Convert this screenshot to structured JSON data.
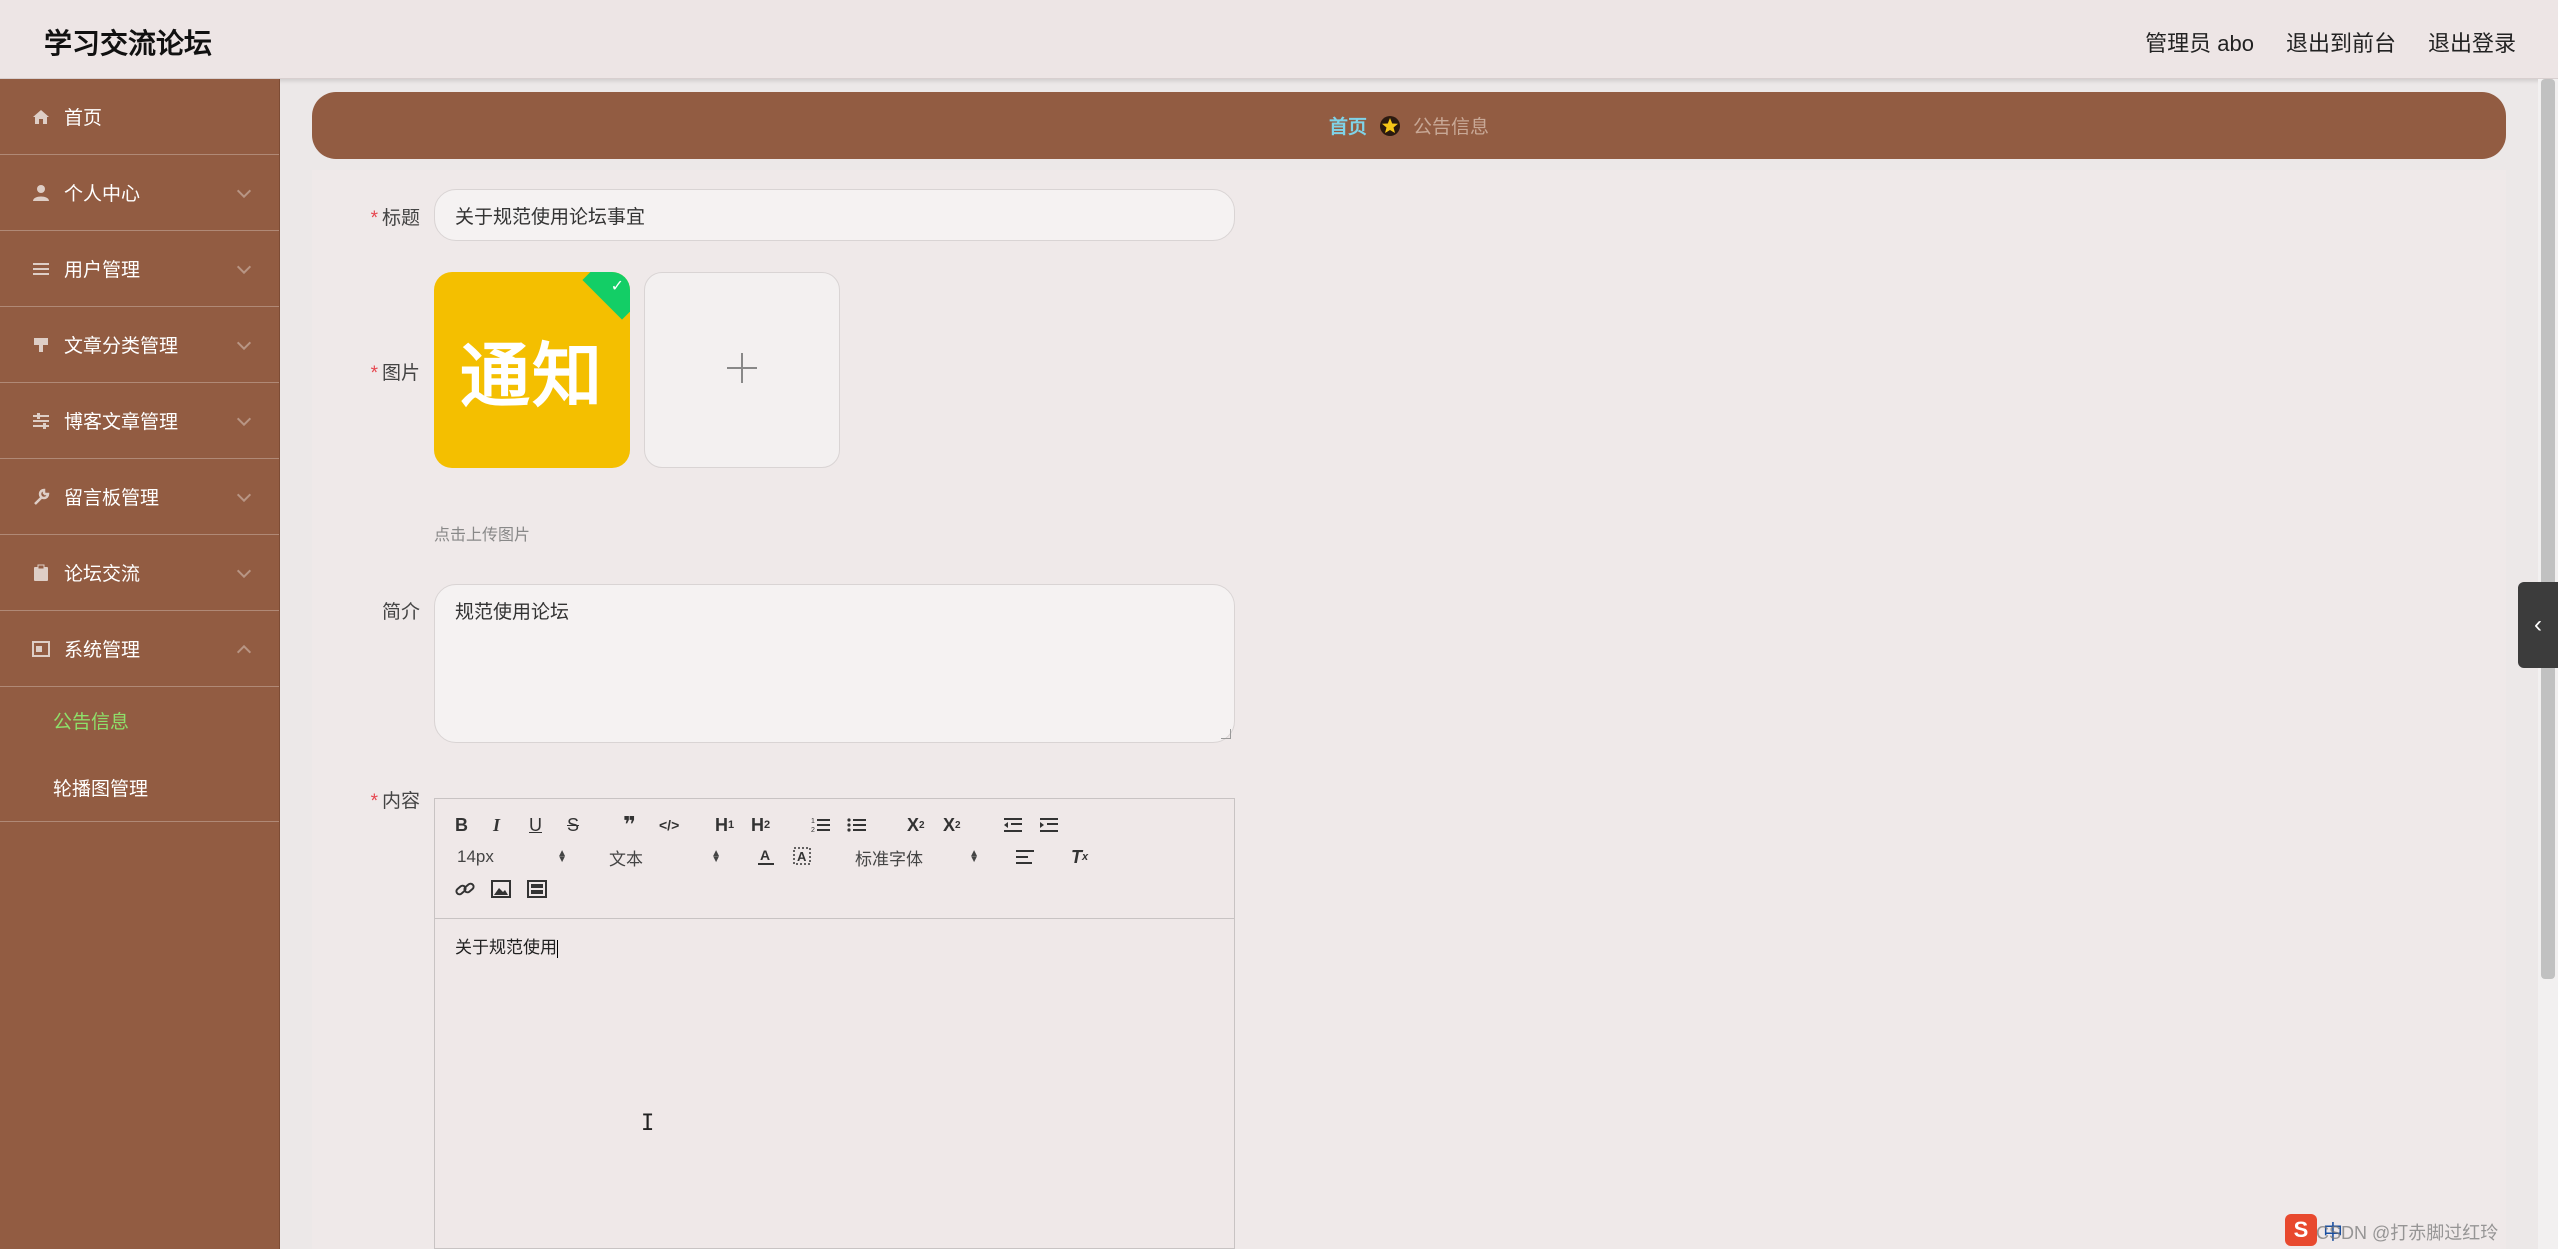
{
  "header": {
    "app_title": "学习交流论坛",
    "admin_label": "管理员 abo",
    "to_frontend": "退出到前台",
    "logout": "退出登录"
  },
  "sidebar": {
    "items": [
      {
        "label": "首页",
        "icon": "home-icon"
      },
      {
        "label": "个人中心",
        "icon": "user-icon"
      },
      {
        "label": "用户管理",
        "icon": "list-icon"
      },
      {
        "label": "文章分类管理",
        "icon": "stamp-icon"
      },
      {
        "label": "博客文章管理",
        "icon": "sliders-icon"
      },
      {
        "label": "留言板管理",
        "icon": "wrench-icon"
      },
      {
        "label": "论坛交流",
        "icon": "clipboard-icon"
      },
      {
        "label": "系统管理",
        "icon": "window-icon"
      }
    ],
    "submenu": [
      {
        "label": "公告信息",
        "active": true
      },
      {
        "label": "轮播图管理",
        "active": false
      }
    ]
  },
  "breadcrumb": {
    "home": "首页",
    "current": "公告信息"
  },
  "form": {
    "title_label": "标题",
    "title_value": "关于规范使用论坛事宜",
    "image_label": "图片",
    "image_thumb_text": "通知",
    "upload_tip": "点击上传图片",
    "intro_label": "简介",
    "intro_value": "规范使用论坛",
    "content_label": "内容"
  },
  "editor": {
    "font_size": "14px",
    "block_format": "文本",
    "font_family": "标准字体",
    "content": "关于规范使用"
  },
  "ime": {
    "mode": "中"
  },
  "watermark": "CSDN @打赤脚过红玲",
  "colors": {
    "brand": "#925c42",
    "header_bg": "#ede5e5",
    "active_sub": "#8ee06a",
    "required": "#e6464f",
    "thumb": "#f4bf00",
    "success": "#13ce66"
  }
}
